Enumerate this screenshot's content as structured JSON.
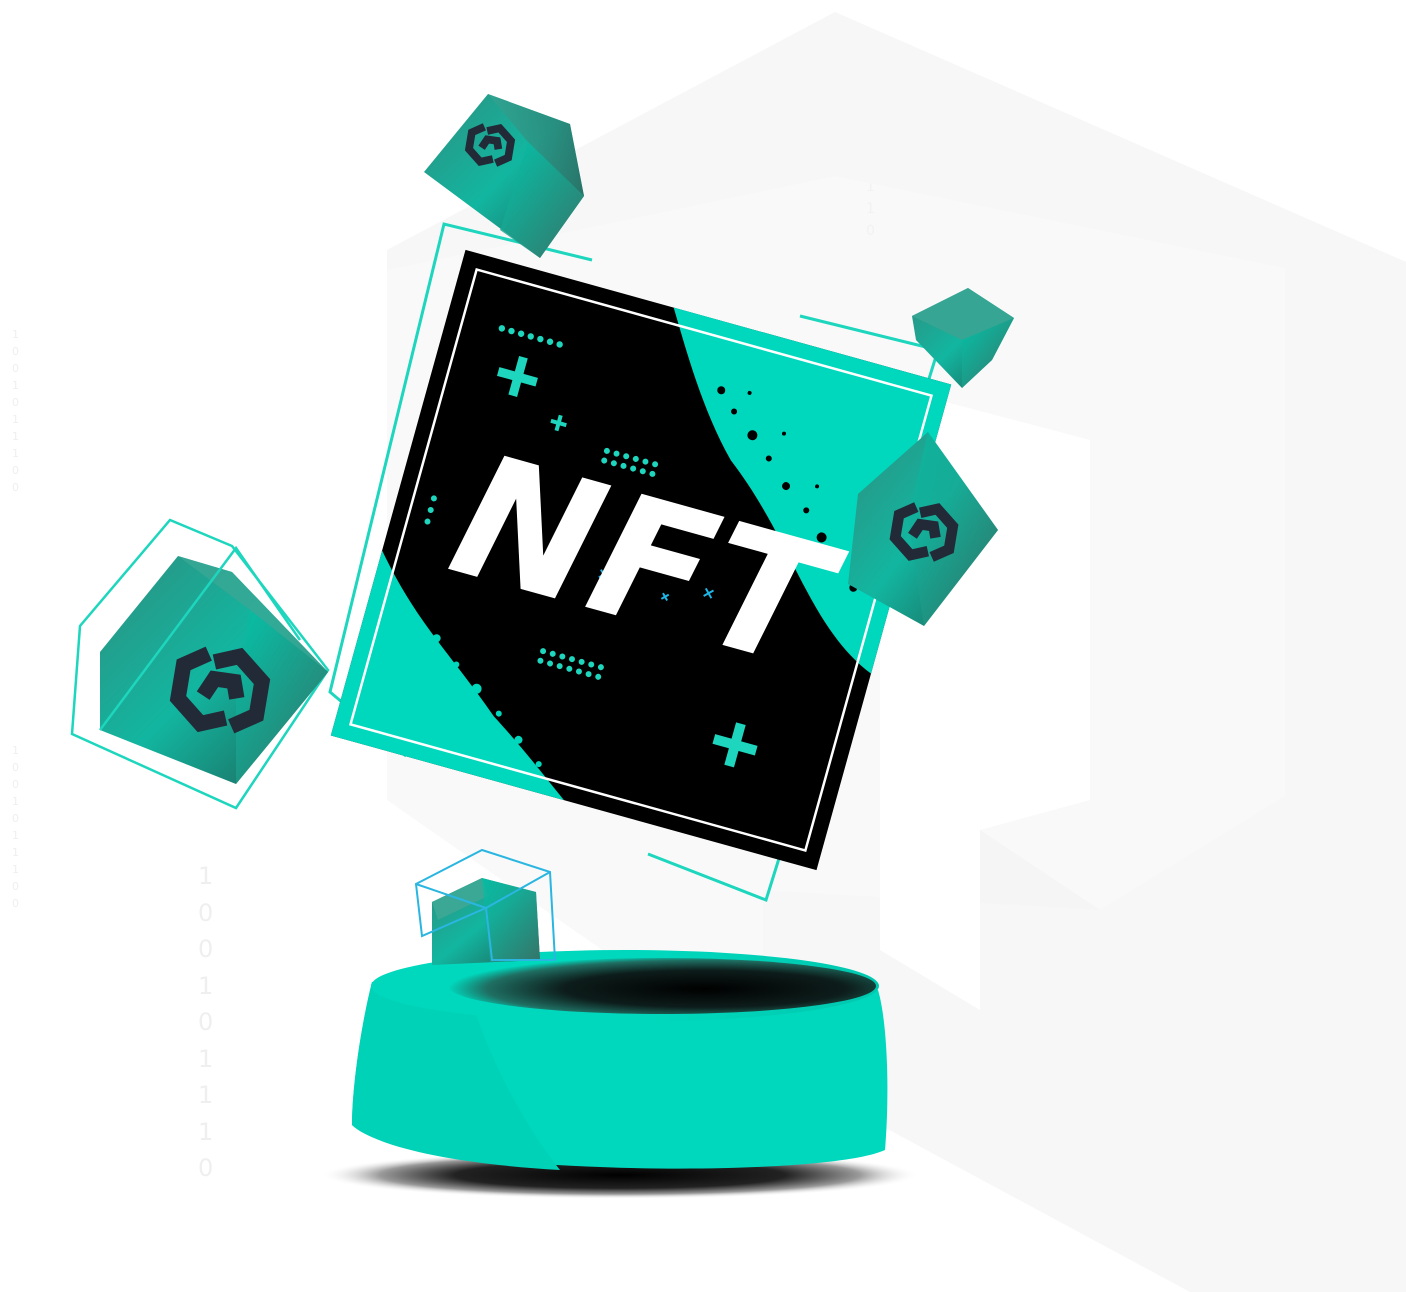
{
  "artwork": {
    "badge_text": "NFT",
    "binary_columns": [
      {
        "id": "binary-top",
        "digits": [
          "1",
          "0",
          "0",
          "1",
          "0",
          "1",
          "1",
          "1",
          "0"
        ]
      },
      {
        "id": "binary-left-1",
        "digits": [
          "1",
          "0",
          "0",
          "1",
          "0",
          "1",
          "1",
          "1",
          "0",
          "0"
        ]
      },
      {
        "id": "binary-left-2",
        "digits": [
          "1",
          "0",
          "0",
          "1",
          "0",
          "1",
          "1",
          "1",
          "0",
          "0"
        ]
      },
      {
        "id": "binary-mid",
        "digits": [
          "1",
          "0",
          "0",
          "1",
          "0",
          "1",
          "1",
          "1",
          "0"
        ]
      }
    ],
    "icons": [
      "background-hexagon-icon",
      "link-chain-icon",
      "cube-icon",
      "pedestal-icon",
      "plus-icon"
    ],
    "colors": {
      "accent": "#00d8bd",
      "accent_dark": "#1f5f55",
      "frame_bg": "#000000",
      "logo": "#222a37",
      "background_shape": "#f7f7f7",
      "binary_text": "#efefef",
      "page_bg": "#ffffff"
    }
  }
}
